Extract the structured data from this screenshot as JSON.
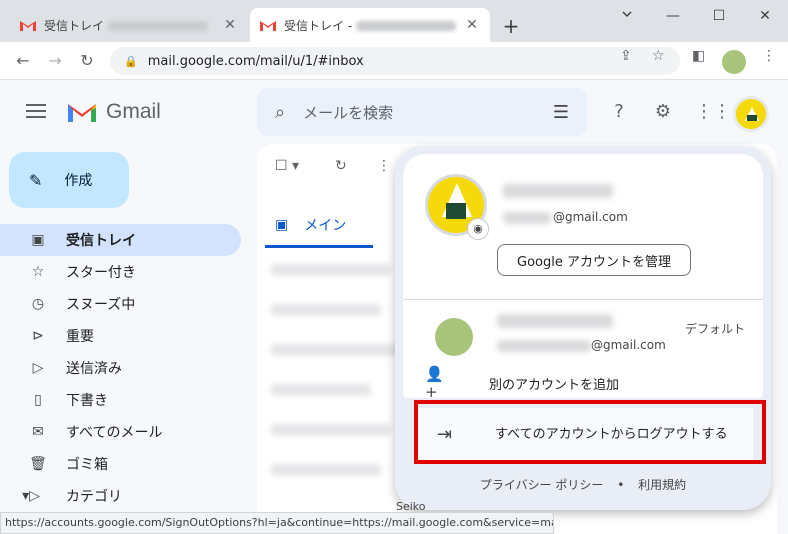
{
  "browser": {
    "tabs": [
      {
        "title": "受信トレイ",
        "close": "✕"
      },
      {
        "title": "受信トレイ -",
        "close": "✕"
      }
    ],
    "new_tab": "+",
    "window_controls": {
      "minimize": "—",
      "maximize": "☐",
      "close": "✕"
    },
    "nav": {
      "back": "←",
      "forward": "→",
      "reload": "↻"
    },
    "url": "mail.google.com/mail/u/1/#inbox",
    "status_url": "https://accounts.google.com/SignOutOptions?hl=ja&continue=https://mail.google.com&service=mail"
  },
  "gmail": {
    "logo_text": "Gmail",
    "search_placeholder": "メールを検索",
    "compose_label": "作成",
    "sidebar": [
      {
        "label": "受信トレイ",
        "icon": "inbox-icon",
        "glyph": "▣",
        "active": true
      },
      {
        "label": "スター付き",
        "icon": "star-icon",
        "glyph": "☆"
      },
      {
        "label": "スヌーズ中",
        "icon": "clock-icon",
        "glyph": "◷"
      },
      {
        "label": "重要",
        "icon": "important-icon",
        "glyph": "⊳"
      },
      {
        "label": "送信済み",
        "icon": "send-icon",
        "glyph": "▷"
      },
      {
        "label": "下書き",
        "icon": "draft-icon",
        "glyph": "▯"
      },
      {
        "label": "すべてのメール",
        "icon": "all-mail-icon",
        "glyph": "✉"
      },
      {
        "label": "ゴミ箱",
        "icon": "trash-icon",
        "glyph": "🗑"
      },
      {
        "label": "カテゴリ",
        "icon": "category-icon",
        "glyph": "▾▷"
      }
    ],
    "main_tab": "メイン",
    "partial_row_text": "Seiko"
  },
  "account_popup": {
    "primary_email_suffix": "@gmail.com",
    "manage_button": "Google アカウントを管理",
    "secondary_email_suffix": "@gmail.com",
    "default_label": "デフォルト",
    "add_account": "別のアカウントを追加",
    "logout_all": "すべてのアカウントからログアウトする",
    "footer_privacy": "プライバシー ポリシー",
    "footer_sep": "•",
    "footer_terms": "利用規約"
  },
  "colors": {
    "highlight_box": "#e00000",
    "active_nav": "#d3e3fd",
    "compose_bg": "#c2e7ff",
    "accent_blue": "#0b57d0"
  }
}
